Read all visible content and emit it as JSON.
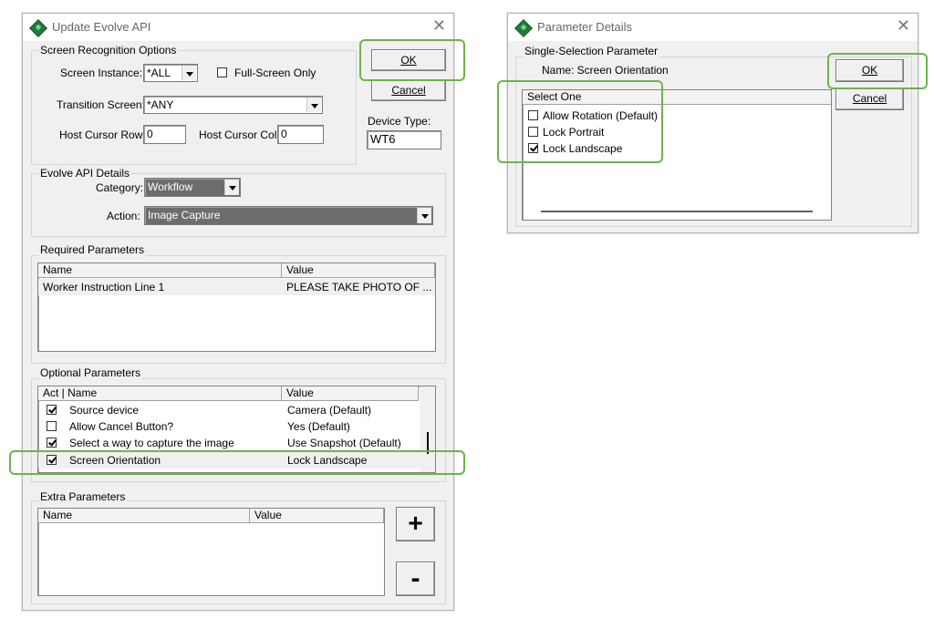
{
  "update_dialog": {
    "title": "Update Evolve API",
    "close_symbol": "✕",
    "screen_recognition": {
      "legend": "Screen Recognition Options",
      "screen_instance_label": "Screen Instance:",
      "screen_instance_value": "*ALL",
      "fullscreen_label": "Full-Screen Only",
      "fullscreen_checked": false,
      "transition_screen_label": "Transition Screen:",
      "transition_screen_value": "*ANY",
      "cursor_row_label": "Host Cursor Row:",
      "cursor_row_value": "0",
      "cursor_col_label": "Host Cursor Col:",
      "cursor_col_value": "0"
    },
    "ok_label": "OK",
    "cancel_label": "Cancel",
    "device_type_label": "Device Type:",
    "device_type_value": "WT6",
    "api_details": {
      "legend": "Evolve API Details",
      "category_label": "Category:",
      "category_value": "Workflow",
      "action_label": "Action:",
      "action_value": "Image Capture"
    },
    "required": {
      "legend": "Required Parameters",
      "col_name": "Name",
      "col_value": "Value",
      "rows": [
        {
          "name": "Worker Instruction Line 1",
          "value": "PLEASE TAKE PHOTO OF ..."
        }
      ]
    },
    "optional": {
      "legend": "Optional Parameters",
      "col_act_name": "Act | Name",
      "col_value": "Value",
      "rows": [
        {
          "checked": true,
          "name": "Source device",
          "value": "Camera (Default)"
        },
        {
          "checked": false,
          "name": "Allow Cancel Button?",
          "value": "Yes (Default)"
        },
        {
          "checked": true,
          "name": "Select a way to capture the image",
          "value": "Use Snapshot (Default)"
        },
        {
          "checked": true,
          "name": "Screen Orientation",
          "value": "Lock Landscape"
        }
      ]
    },
    "extra": {
      "legend": "Extra Parameters",
      "col_name": "Name",
      "col_value": "Value",
      "add_label": "+",
      "remove_label": "-"
    }
  },
  "param_dialog": {
    "title": "Parameter Details",
    "close_symbol": "✕",
    "legend": "Single-Selection Parameter",
    "name_line": "Name: Screen Orientation",
    "ok_label": "OK",
    "cancel_label": "Cancel",
    "list_header": "Select One",
    "options": [
      {
        "label": "Allow Rotation (Default)",
        "checked": false
      },
      {
        "label": "Lock Portrait",
        "checked": false
      },
      {
        "label": "Lock Landscape",
        "checked": true
      }
    ]
  },
  "colors": {
    "highlight": "#6cb44a",
    "dialog_bg": "#f0f0f0",
    "action_field_bg": "#6d6d6d"
  }
}
